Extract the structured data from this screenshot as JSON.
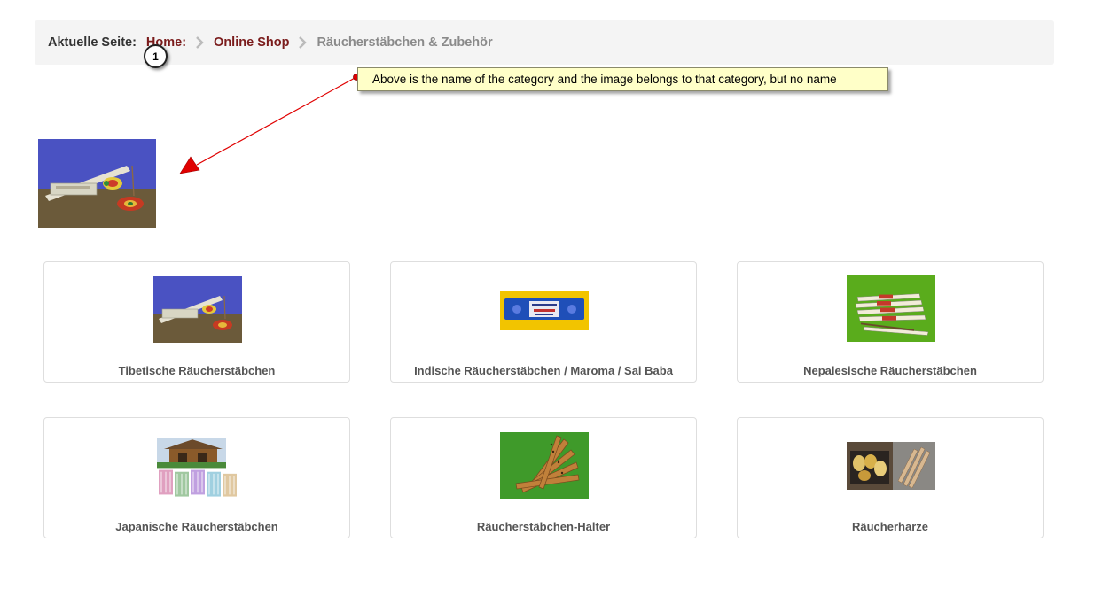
{
  "breadcrumb": {
    "label": "Aktuelle Seite:",
    "items": [
      {
        "label": "Home:"
      },
      {
        "label": "Online Shop"
      },
      {
        "label": "Räucherstäbchen & Zubehör"
      }
    ]
  },
  "annotation": {
    "number": "1",
    "note": "Above is the name of the category and the image belongs to that category, but no name",
    "arrow_color": "#e00000"
  },
  "colors": {
    "link": "#7a1b1b",
    "current": "#8a8a8a",
    "breadcrumb_bg": "#f4f4f4",
    "note_bg": "#ffffc8"
  },
  "categories": [
    {
      "title": "Tibetische Räucherstäbchen",
      "image": "incense-sticks-with-holder"
    },
    {
      "title": "Indische Räucherstäbchen / Maroma / Sai Baba",
      "image": "nag-champa-package"
    },
    {
      "title": "Nepalesische Räucherstäbchen",
      "image": "nepalese-incense-bundles"
    },
    {
      "title": "Japanische Räucherstäbchen",
      "image": "japanese-temple-incense"
    },
    {
      "title": "Räucherstäbchen-Halter",
      "image": "wooden-incense-holders"
    },
    {
      "title": "Räucherharze",
      "image": "resin-and-wood"
    }
  ]
}
